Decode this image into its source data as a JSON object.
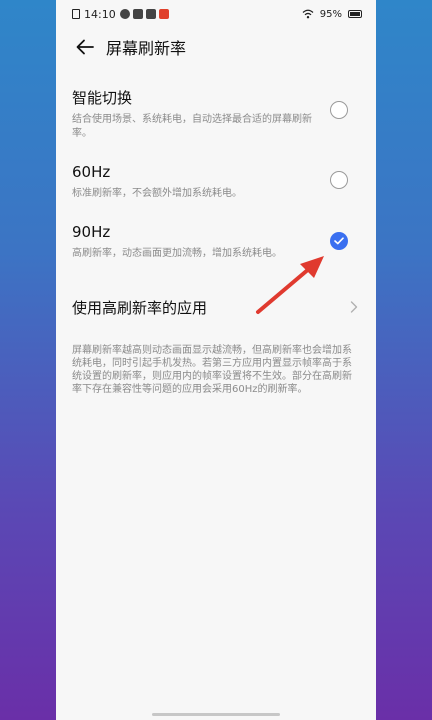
{
  "status": {
    "time": "14:10",
    "battery": "95%"
  },
  "header": {
    "title": "屏幕刷新率"
  },
  "options": [
    {
      "label": "智能切换",
      "desc": "结合使用场景、系统耗电，自动选择最合适的屏幕刷新率。",
      "selected": false
    },
    {
      "label": "60Hz",
      "desc": "标准刷新率，不会额外增加系统耗电。",
      "selected": false
    },
    {
      "label": "90Hz",
      "desc": "高刷新率，动态画面更加流畅，增加系统耗电。",
      "selected": true
    }
  ],
  "apps_link": {
    "label": "使用高刷新率的应用"
  },
  "note": "屏幕刷新率越高则动态画面显示越流畅，但高刷新率也会增加系统耗电，同时引起手机发热。若第三方应用内置显示帧率高于系统设置的刷新率，则应用内的帧率设置将不生效。部分在高刷新率下存在兼容性等问题的应用会采用60Hz的刷新率。",
  "colors": {
    "accent": "#3a6ff0",
    "annotation_arrow": "#e03a2f"
  }
}
